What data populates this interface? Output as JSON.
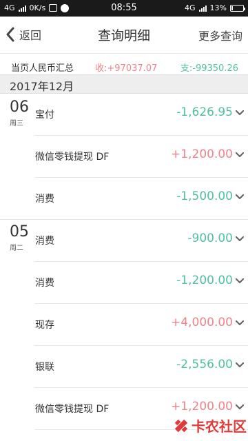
{
  "status_bar": {
    "network": "4G",
    "speed": "0K/s",
    "time": "08:55",
    "network_right": "4G",
    "battery": "13%",
    "battery_level": 0.13
  },
  "nav": {
    "back_label": "返回",
    "title": "查询明细",
    "more_label": "更多查询"
  },
  "summary": {
    "label": "当页人民币汇总",
    "income": "收:+97037.07",
    "expense": "支:-99350.26"
  },
  "month": "2017年12月",
  "days": [
    {
      "day": "06",
      "weekday": "周三"
    },
    {
      "day": "05",
      "weekday": "周二"
    }
  ],
  "transactions": [
    {
      "name": "宝付",
      "amount": "-1,626.95",
      "type": "neg"
    },
    {
      "name": "微信零钱提现 DF",
      "amount": "+1,200.00",
      "type": "pos"
    },
    {
      "name": "消费",
      "amount": "-1,500.00",
      "type": "neg"
    },
    {
      "name": "消费",
      "amount": "-900.00",
      "type": "neg"
    },
    {
      "name": "消费",
      "amount": "-1,200.00",
      "type": "neg"
    },
    {
      "name": "现存",
      "amount": "+4,000.00",
      "type": "pos"
    },
    {
      "name": "银联",
      "amount": "-2,556.00",
      "type": "neg"
    },
    {
      "name": "微信零钱提现 DF",
      "amount": "+1,200.00",
      "type": "pos"
    }
  ],
  "watermark": "卡农社区",
  "colors": {
    "income": "#f0828a",
    "expense": "#4fc1a0",
    "watermark": "#e03a3a"
  }
}
